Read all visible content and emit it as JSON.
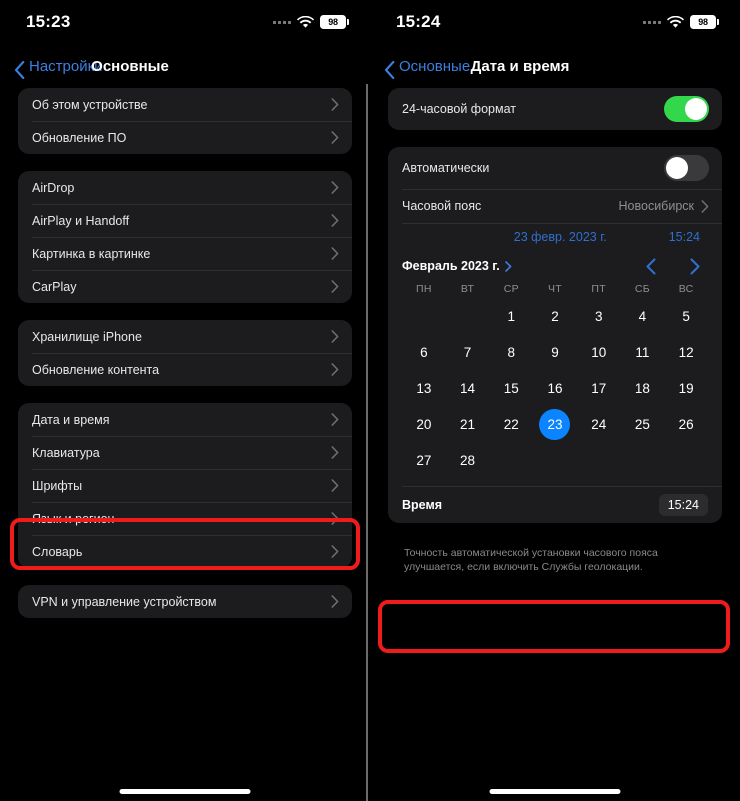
{
  "left": {
    "statusbar": {
      "time": "15:23",
      "battery": "98",
      "signal_icon": "signal-dots-icon",
      "wifi_icon": "wifi-icon",
      "battery_icon": "battery-icon"
    },
    "nav": {
      "back_label": "Настройки",
      "title": "Основные"
    },
    "groups": [
      {
        "rows": [
          {
            "label": "Об этом устройстве"
          },
          {
            "label": "Обновление ПО"
          }
        ]
      },
      {
        "rows": [
          {
            "label": "AirDrop"
          },
          {
            "label": "AirPlay и Handoff"
          },
          {
            "label": "Картинка в картинке"
          },
          {
            "label": "CarPlay"
          }
        ]
      },
      {
        "rows": [
          {
            "label": "Хранилище iPhone"
          },
          {
            "label": "Обновление контента"
          }
        ]
      },
      {
        "rows": [
          {
            "label": "Дата и время"
          },
          {
            "label": "Клавиатура"
          },
          {
            "label": "Шрифты"
          },
          {
            "label": "Язык и регион"
          },
          {
            "label": "Словарь"
          }
        ]
      },
      {
        "rows": [
          {
            "label": "VPN и управление устройством"
          }
        ]
      }
    ]
  },
  "right": {
    "statusbar": {
      "time": "15:24",
      "battery": "98",
      "signal_icon": "signal-dots-icon",
      "wifi_icon": "wifi-icon",
      "battery_icon": "battery-icon"
    },
    "nav": {
      "back_label": "Основные",
      "title": "Дата и время"
    },
    "hour_format": {
      "label": "24-часовой формат",
      "state": "on"
    },
    "automatic": {
      "label": "Автоматически",
      "state": "off"
    },
    "timezone": {
      "label": "Часовой пояс",
      "value": "Новосибирск"
    },
    "summary": {
      "date": "23 февр. 2023 г.",
      "time": "15:24"
    },
    "calendar": {
      "month_label": "Февраль 2023 г.",
      "prev_icon": "chevron-left-icon",
      "next_icon": "chevron-right-icon",
      "weekdays": [
        "ПН",
        "ВТ",
        "СР",
        "ЧТ",
        "ПТ",
        "СБ",
        "ВС"
      ],
      "leading_blanks": 2,
      "days": [
        1,
        2,
        3,
        4,
        5,
        6,
        7,
        8,
        9,
        10,
        11,
        12,
        13,
        14,
        15,
        16,
        17,
        18,
        19,
        20,
        21,
        22,
        23,
        24,
        25,
        26,
        27,
        28
      ],
      "selected_day": 23
    },
    "time_row": {
      "label": "Время",
      "value": "15:24"
    },
    "footnote": "Точность автоматической установки часового пояса улучшается, если включить Службы геолокации."
  },
  "highlights": {
    "color": "#f01c1c",
    "left_target": "Дата и время",
    "right_target": "Время"
  }
}
